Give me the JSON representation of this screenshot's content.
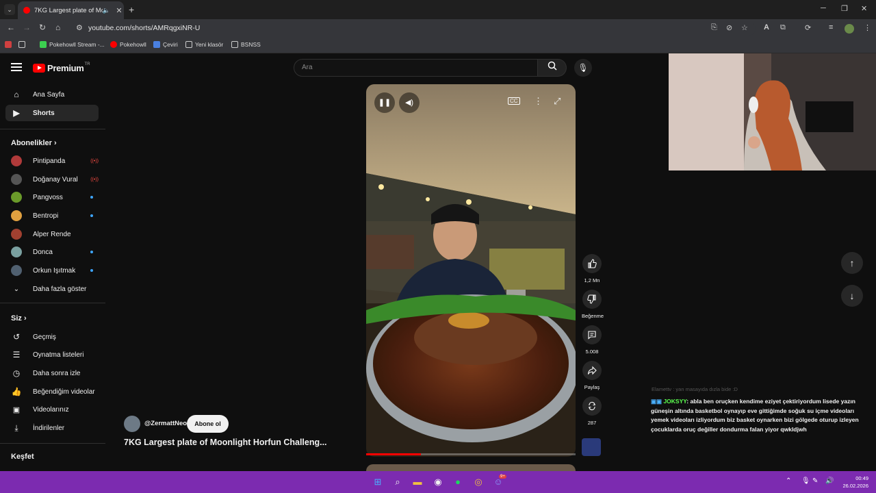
{
  "browser": {
    "tab_title": "7KG Largest plate of Moonl",
    "url": "youtube.com/shorts/AMRqgxiNR-U",
    "bookmarks": [
      "Pokehowll Stream -...",
      "Pokehowll",
      "Çeviri",
      "Yeni klasör",
      "BSNSS"
    ]
  },
  "youtube": {
    "logo_text": "Premium",
    "logo_country": "TR",
    "search_placeholder": "Ara",
    "nav": [
      {
        "label": "Ana Sayfa",
        "icon": "home-icon"
      },
      {
        "label": "Shorts",
        "icon": "shorts-icon",
        "active": true
      }
    ],
    "subscriptions_title": "Abonelikler",
    "subscriptions": [
      {
        "label": "Pintipanda",
        "badge": "live",
        "color": "#b03a3a"
      },
      {
        "label": "Doğanay Vural",
        "badge": "live",
        "color": "#555555"
      },
      {
        "label": "Pangvoss",
        "badge": "dot",
        "color": "#6a9a2a"
      },
      {
        "label": "Bentropi",
        "badge": "dot",
        "color": "#e0a040"
      },
      {
        "label": "Alper Rende",
        "badge": "none",
        "color": "#a04030"
      },
      {
        "label": "Donca",
        "badge": "dot",
        "color": "#7aa0a0"
      },
      {
        "label": "Orkun Işıtmak",
        "badge": "dot",
        "color": "#506070"
      }
    ],
    "show_more": "Daha fazla göster",
    "you_title": "Siz",
    "you_items": [
      {
        "label": "Geçmiş",
        "icon": "history-icon"
      },
      {
        "label": "Oynatma listeleri",
        "icon": "playlist-icon"
      },
      {
        "label": "Daha sonra izle",
        "icon": "clock-icon"
      },
      {
        "label": "Beğendiğim videolar",
        "icon": "like-icon"
      },
      {
        "label": "Videolarınız",
        "icon": "video-icon"
      },
      {
        "label": "İndirilenler",
        "icon": "download-icon"
      }
    ],
    "explore_title": "Keşfet",
    "short": {
      "channel": "@ZermattNeo",
      "subscribe": "Abone ol",
      "title": "7KG Largest plate of Moonlight Horfun Challeng...",
      "likes": "1,2 Mn",
      "dislike": "Beğenme",
      "comments": "5.008",
      "share": "Paylaş",
      "remix": "287",
      "progress": 0.26
    }
  },
  "stream": {
    "chat_faded": "Elamettv : yan masayıda dızla bide :D",
    "chat_user": "JOKSYY",
    "chat_message": ": abla ben oruçken kendime eziyet çektiriyordum lisede yazın güneşin altında basketbol oynayıp eve gittiğimde soğuk su içme videoları yemek videoları izliyordum biz basket oynarken bizi gölgede oturup izleyen çocuklarda oruç değiller dondurma falan yiyor qwkldjwh"
  },
  "taskbar": {
    "time": "00:49",
    "date": "26.02.2026",
    "discord_badge": "9+"
  }
}
